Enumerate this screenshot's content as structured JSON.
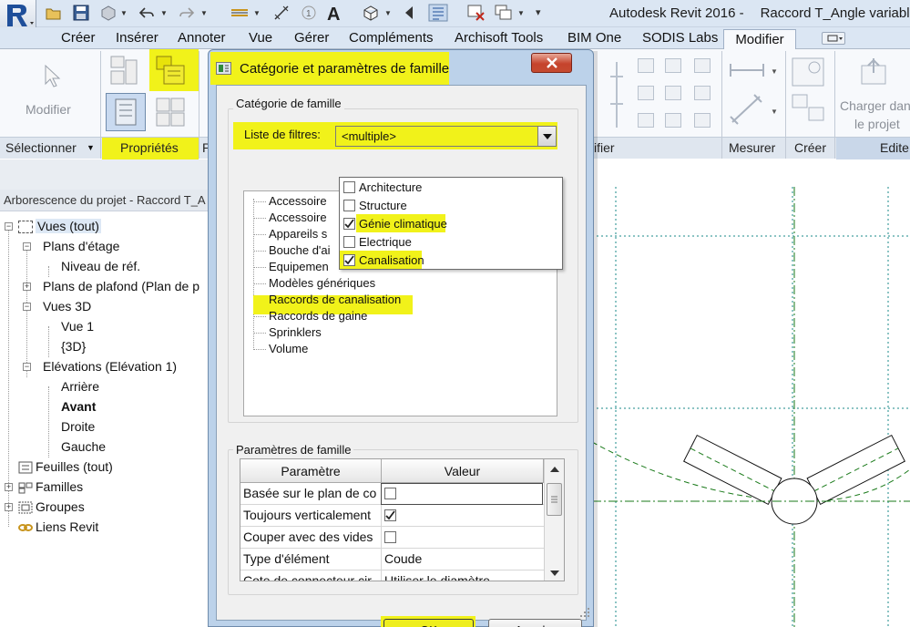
{
  "window": {
    "app_title": "Autodesk Revit 2016 -",
    "doc_title": "Raccord T_Angle variable"
  },
  "tabs": [
    "Créer",
    "Insérer",
    "Annoter",
    "Vue",
    "Gérer",
    "Compléments",
    "Archisoft Tools",
    "BIM One",
    "SODIS Labs"
  ],
  "active_tab": "Modifier",
  "ribbon": {
    "modify_button": "Modifier",
    "load_button_line1": "Charger dan",
    "load_button_line2": "le projet",
    "panels": {
      "select": "Sélectionner",
      "properties": "Propriétés",
      "partial": "P",
      "geometry_partial": "ifier",
      "measure": "Mesurer",
      "create": "Créer",
      "edit_partial": "Edite"
    }
  },
  "project_browser": {
    "title": "Arborescence du projet - Raccord T_A",
    "items": [
      {
        "label": "Vues (tout)"
      },
      {
        "label": "Plans d'étage"
      },
      {
        "label": "Niveau de réf."
      },
      {
        "label": "Plans de plafond (Plan de p"
      },
      {
        "label": "Vues 3D"
      },
      {
        "label": "Vue 1"
      },
      {
        "label": "{3D}"
      },
      {
        "label": "Elévations (Elévation 1)"
      },
      {
        "label": "Arrière"
      },
      {
        "label": "Avant"
      },
      {
        "label": "Droite"
      },
      {
        "label": "Gauche"
      },
      {
        "label": "Feuilles (tout)"
      },
      {
        "label": "Familles"
      },
      {
        "label": "Groupes"
      },
      {
        "label": "Liens Revit"
      }
    ]
  },
  "dialog": {
    "title": "Catégorie et paramètres de famille",
    "category_group": "Catégorie de famille",
    "filter_label": "Liste de filtres:",
    "filter_value": "<multiple>",
    "categories": [
      "Accessoire",
      "Accessoire",
      "Appareils s",
      "Bouche d'ai",
      "Equipemen",
      "Modèles génériques",
      "Raccords de canalisation",
      "Raccords de gaine",
      "Sprinklers",
      "Volume"
    ],
    "selected_category": "Raccords de canalisation",
    "filter_options": [
      {
        "label": "Architecture",
        "checked": false
      },
      {
        "label": "Structure",
        "checked": false
      },
      {
        "label": "Génie climatique",
        "checked": true
      },
      {
        "label": "Electrique",
        "checked": false
      },
      {
        "label": "Canalisation",
        "checked": true
      }
    ],
    "params_group": "Paramètres de famille",
    "param_headers": [
      "Paramètre",
      "Valeur"
    ],
    "params": [
      {
        "name": "Basée sur le plan de co",
        "value": "",
        "checkbox": true,
        "checked": false
      },
      {
        "name": "Toujours verticalement",
        "value": "",
        "checkbox": true,
        "checked": true
      },
      {
        "name": "Couper avec des vides",
        "value": "",
        "checkbox": true,
        "checked": false
      },
      {
        "name": "Type d'élément",
        "value": "Coude",
        "checkbox": false
      },
      {
        "name": "Cote de connecteur cir",
        "value": "Utiliser le diamètre",
        "checkbox": false
      }
    ],
    "ok": "OK",
    "cancel": "Annuler"
  },
  "colors": {
    "highlight": "#f1f21a",
    "ribbon_bg": "#dbe6f3",
    "dialog_frame": "#bcd2ea",
    "canvas_grid": "#1a8a8a",
    "canvas_centerline": "#1a7a1a"
  }
}
